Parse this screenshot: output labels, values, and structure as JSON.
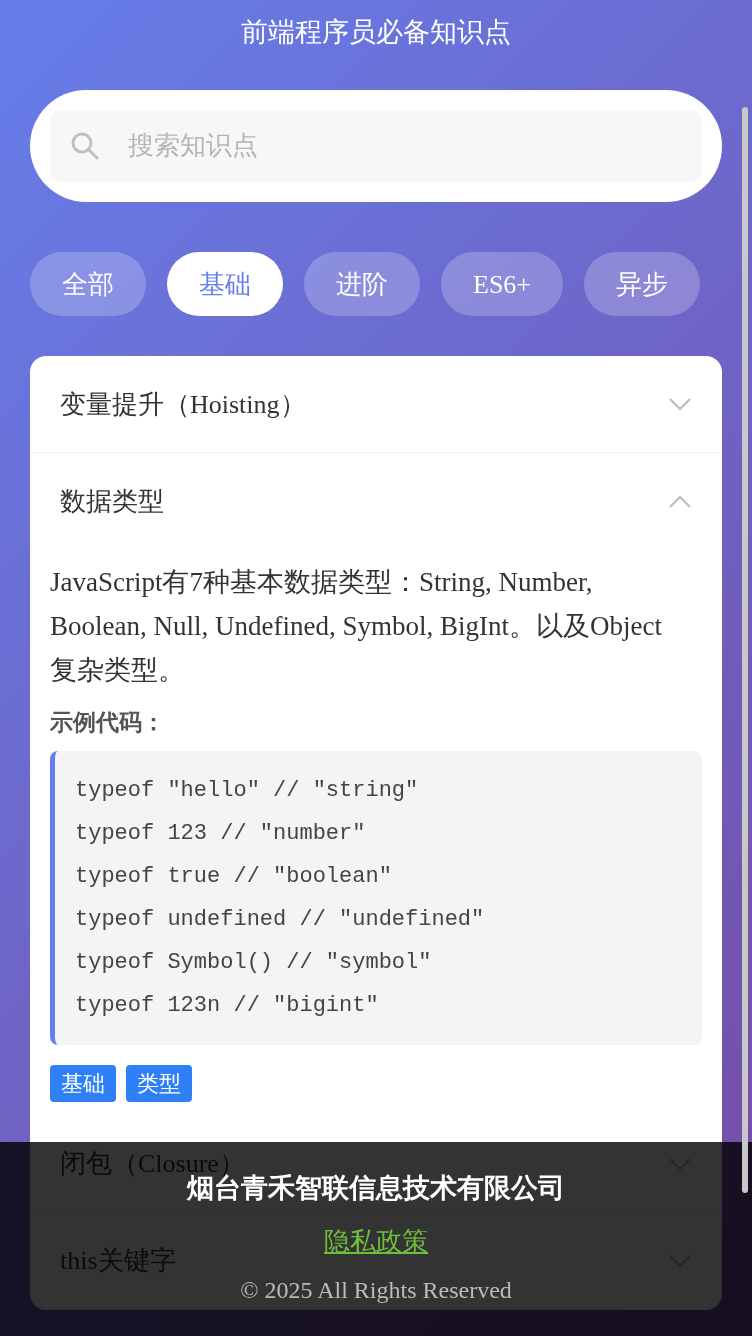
{
  "header": {
    "title": "前端程序员必备知识点"
  },
  "search": {
    "placeholder": "搜索知识点"
  },
  "tabs": [
    {
      "label": "全部",
      "selected": false
    },
    {
      "label": "基础",
      "selected": true
    },
    {
      "label": "进阶",
      "selected": false
    },
    {
      "label": "ES6+",
      "selected": false
    },
    {
      "label": "异步",
      "selected": false
    }
  ],
  "items": [
    {
      "title": "变量提升（Hoisting）",
      "expanded": false
    },
    {
      "title": "数据类型",
      "expanded": true,
      "description": "JavaScript有7种基本数据类型：String, Number, Boolean, Null, Undefined, Symbol, BigInt。以及Object复杂类型。",
      "example_label": "示例代码：",
      "code": [
        "typeof \"hello\" // \"string\"",
        "typeof 123 // \"number\"",
        "typeof true // \"boolean\"",
        "typeof undefined // \"undefined\"",
        "typeof Symbol() // \"symbol\"",
        "typeof 123n // \"bigint\""
      ],
      "tags": [
        "基础",
        "类型"
      ]
    },
    {
      "title": "闭包（Closure）",
      "expanded": false
    },
    {
      "title": "this关键字",
      "expanded": false
    }
  ],
  "footer": {
    "company": "烟台青禾智联信息技术有限公司",
    "link": "隐私政策",
    "copyright": "© 2025 All Rights Reserved"
  }
}
